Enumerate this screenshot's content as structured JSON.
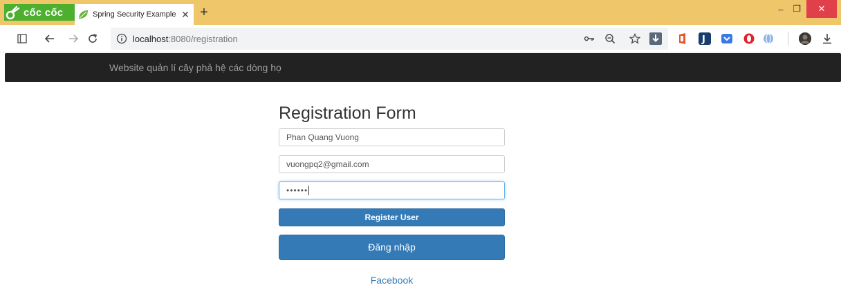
{
  "browser": {
    "brand_name": "cốc cốc",
    "tab": {
      "title": "Spring Security Example",
      "close_glyph": "✕"
    },
    "new_tab_glyph": "+",
    "window": {
      "minimize_glyph": "–",
      "maximize_glyph": "❐",
      "close_glyph": "✕"
    },
    "address": {
      "host": "localhost",
      "rest": ":8080/registration"
    },
    "colors": {
      "tabstrip": "#f0c66b",
      "brand": "#4caf2d",
      "close": "#e0404a"
    }
  },
  "site": {
    "navbar_brand": "Website quản lí cây phả hệ các dòng họ"
  },
  "form": {
    "title": "Registration Form",
    "name_value": "Phan Quang Vuong",
    "email_value": "vuongpq2@gmail.com",
    "password_value": "••••••",
    "register_label": "Register User",
    "login_label": "Đăng nhập",
    "facebook_label": "Facebook",
    "colors": {
      "primary": "#337ab7",
      "navbar": "#222222"
    }
  }
}
